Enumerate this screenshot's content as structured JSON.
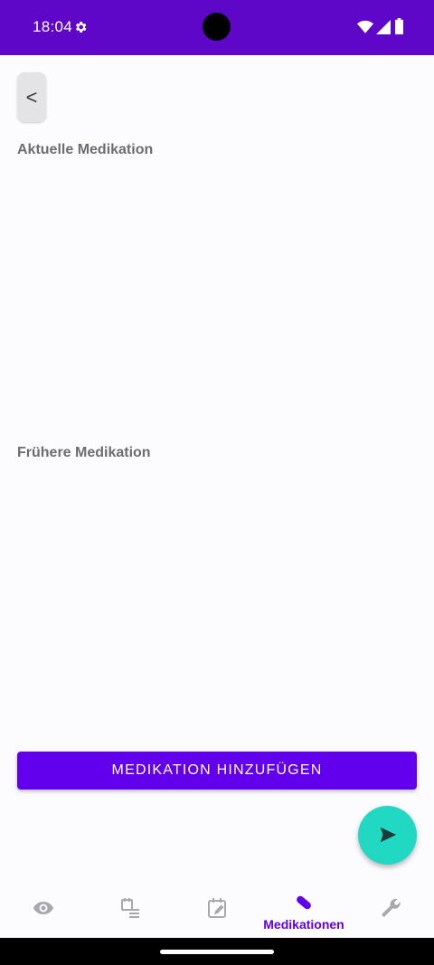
{
  "status_bar": {
    "time": "18:04",
    "background": "#5e07c9",
    "icons": [
      "gear-icon",
      "wifi-icon",
      "cellular-signal-icon",
      "battery-icon"
    ]
  },
  "header": {
    "back_label": "<"
  },
  "sections": {
    "current_title": "Aktuelle Medikation",
    "past_title": "Frühere Medikation"
  },
  "actions": {
    "add_medication_label": "MEDIKATION HINZUFÜGEN",
    "fab_icon": "play-arrow-icon"
  },
  "bottom_nav": {
    "active_index": 3,
    "items": [
      {
        "icon": "eye-icon",
        "label": ""
      },
      {
        "icon": "calendar-list-icon",
        "label": ""
      },
      {
        "icon": "calendar-note-icon",
        "label": ""
      },
      {
        "icon": "pill-icon",
        "label": "Medikationen"
      },
      {
        "icon": "wrench-icon",
        "label": ""
      }
    ]
  },
  "colors": {
    "primary": "#6200ee",
    "fab": "#21d8c2",
    "inactive_icon": "#a8a8ad"
  }
}
